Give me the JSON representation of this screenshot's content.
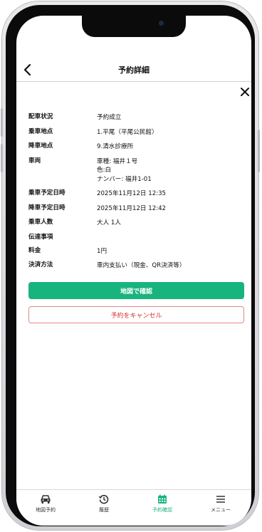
{
  "header": {
    "title": "予約詳細"
  },
  "details": [
    {
      "label": "配車状況",
      "values": [
        "予約成立"
      ]
    },
    {
      "label": "乗車地点",
      "values": [
        "1.平尾（平尾公民館）"
      ]
    },
    {
      "label": "降車地点",
      "values": [
        "9.清水診療所"
      ]
    },
    {
      "label": "車両",
      "values": [
        "車種: 福井１号",
        "色:白",
        "ナンバー: 福井1-01"
      ]
    },
    {
      "label": "乗車予定日時",
      "values": [
        "2025年11月12日 12:35"
      ]
    },
    {
      "label": "降車予定日時",
      "values": [
        "2025年11月12日 12:42"
      ]
    },
    {
      "label": "乗車人数",
      "values": [
        "大人 1人"
      ]
    },
    {
      "label": "伝達事項",
      "values": [
        ""
      ]
    },
    {
      "label": "料金",
      "values": [
        "1円"
      ]
    },
    {
      "label": "決済方法",
      "values": [
        "車内支払い（現金、QR決済等）"
      ]
    }
  ],
  "actions": {
    "map": "地図で確認",
    "cancel": "予約をキャンセル"
  },
  "tabs": [
    {
      "label": "地図予約",
      "icon": "car-icon",
      "active": false
    },
    {
      "label": "履歴",
      "icon": "history-icon",
      "active": false
    },
    {
      "label": "予約確認",
      "icon": "calendar-icon",
      "active": true
    },
    {
      "label": "メニュー",
      "icon": "menu-icon",
      "active": false
    }
  ],
  "colors": {
    "accent": "#18b47e",
    "danger": "#d93232"
  }
}
